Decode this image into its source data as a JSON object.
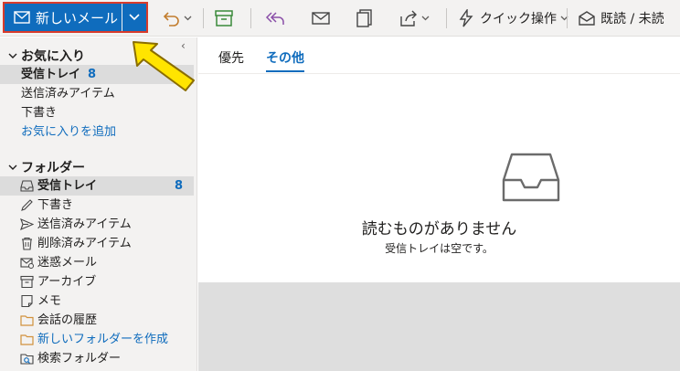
{
  "toolbar": {
    "new_mail_label": "新しいメール",
    "quick_actions_label": "クイック操作",
    "read_unread_label": "既読 / 未読"
  },
  "sidebar": {
    "favorites_header": "お気に入り",
    "favorites": [
      {
        "label": "受信トレイ",
        "count": "8"
      },
      {
        "label": "送信済みアイテム"
      },
      {
        "label": "下書き"
      },
      {
        "label": "お気に入りを追加"
      }
    ],
    "folders_header": "フォルダー",
    "folders": [
      {
        "label": "受信トレイ",
        "count": "8",
        "icon": "inbox-icon"
      },
      {
        "label": "下書き",
        "icon": "pencil-icon"
      },
      {
        "label": "送信済みアイテム",
        "icon": "send-icon"
      },
      {
        "label": "削除済みアイテム",
        "icon": "trash-icon"
      },
      {
        "label": "迷惑メール",
        "icon": "junk-icon"
      },
      {
        "label": "アーカイブ",
        "icon": "archive-icon"
      },
      {
        "label": "メモ",
        "icon": "note-icon"
      },
      {
        "label": "会話の履歴",
        "icon": "folder-icon"
      },
      {
        "label": "新しいフォルダーを作成",
        "icon": "folder-icon"
      },
      {
        "label": "検索フォルダー",
        "icon": "search-folder-icon"
      }
    ]
  },
  "main": {
    "tabs": [
      {
        "label": "優先"
      },
      {
        "label": "その他"
      }
    ],
    "empty_title": "読むものがありません",
    "empty_subtitle": "受信トレイは空です。"
  },
  "colors": {
    "accent": "#0f6cbd",
    "highlight_border": "#d83b2b",
    "annotation_arrow": "#ffe400"
  }
}
